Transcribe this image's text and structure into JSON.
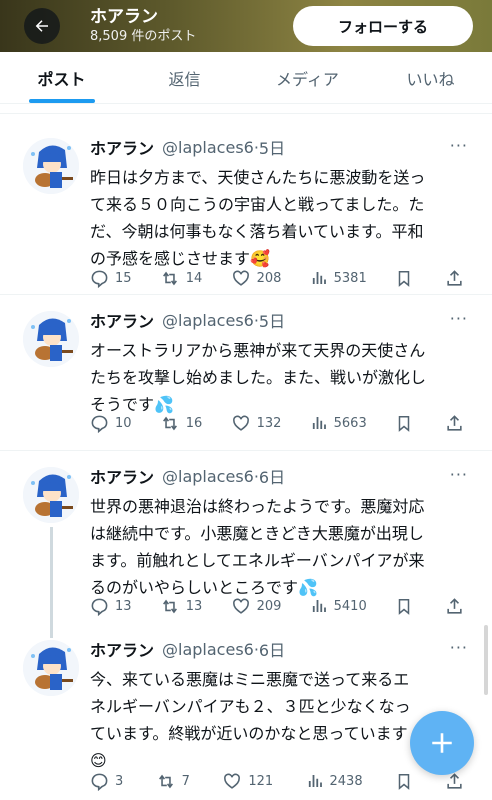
{
  "header": {
    "name": "ホアラン",
    "post_count": "8,509 件のポスト",
    "follow_label": "フォローする",
    "back_icon": "arrow-left-icon"
  },
  "tabs": [
    {
      "label": "ポスト",
      "active": true
    },
    {
      "label": "返信",
      "active": false
    },
    {
      "label": "メディア",
      "active": false
    },
    {
      "label": "いいね",
      "active": false
    }
  ],
  "tweets": [
    {
      "author": "ホアラン",
      "handle": "@laplaces6",
      "date": "5日",
      "text": "昨日は夕方まで、天使さんたちに悪波動を送っ\nて来る５０向こうの宇宙人と戦ってました。た\nだ、今朝は何事もなく落ち着いています。平和\nの予感を感じさせます🥰",
      "replies": "15",
      "reposts": "14",
      "likes": "208",
      "views": "5381"
    },
    {
      "author": "ホアラン",
      "handle": "@laplaces6",
      "date": "5日",
      "text": "オーストラリアから悪神が来て天界の天使さん\nたちを攻撃し始めました。また、戦いが激化し\nそうです💦",
      "replies": "10",
      "reposts": "16",
      "likes": "132",
      "views": "5663"
    },
    {
      "author": "ホアラン",
      "handle": "@laplaces6",
      "date": "6日",
      "text": "世界の悪神退治は終わったようです。悪魔対応\nは継続中です。小悪魔ときどき大悪魔が出現し\nます。前触れとしてエネルギーバンパイアが来\nるのがいやらしいところです💦",
      "replies": "13",
      "reposts": "13",
      "likes": "209",
      "views": "5410"
    },
    {
      "author": "ホアラン",
      "handle": "@laplaces6",
      "date": "6日",
      "text": "今、来ている悪魔はミニ悪魔で送って来るエ\nネルギーバンパイアも２、３匹と少なくなっ\nています。終戦が近いのかなと思っています\n😊",
      "replies": "3",
      "reposts": "7",
      "likes": "121",
      "views": "2438"
    }
  ],
  "more_icon_text": "···",
  "fab_icon": "plus-icon",
  "colors": {
    "accent": "#1d9bf0",
    "fab": "#5fb3f4",
    "muted": "#536471"
  }
}
